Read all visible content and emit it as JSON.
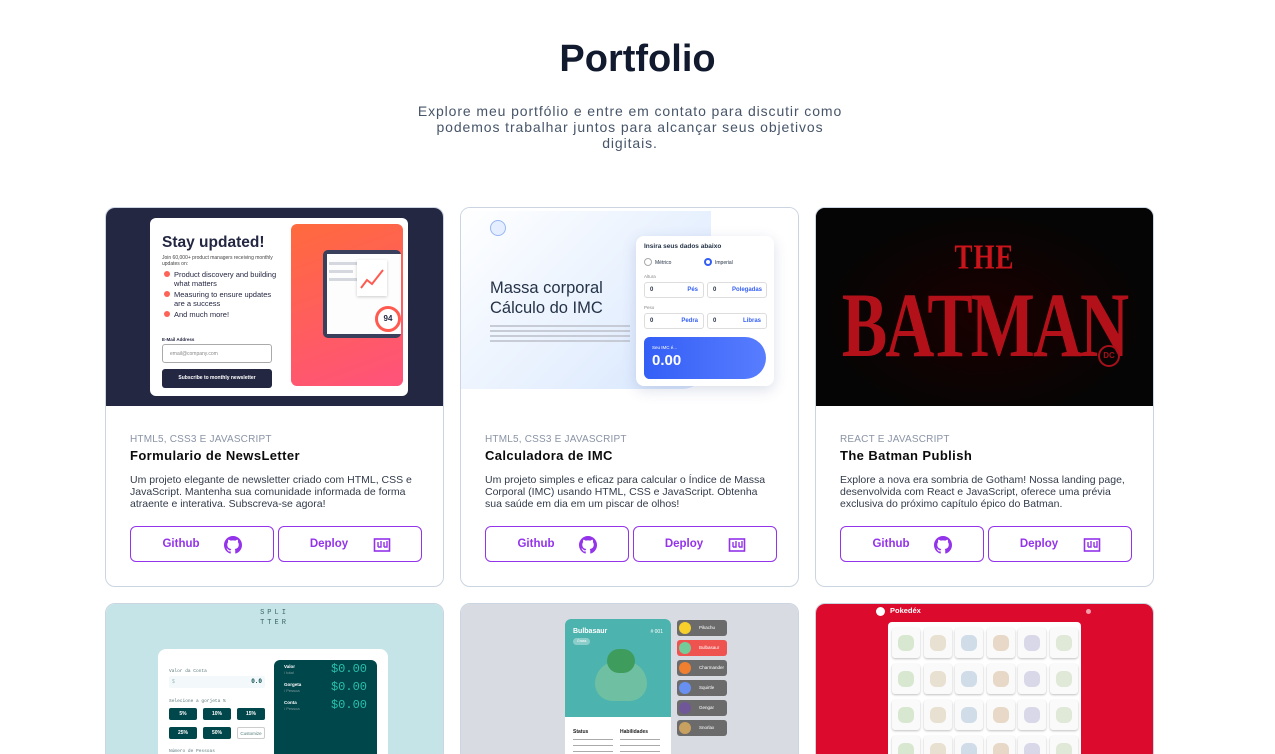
{
  "header": {
    "title": "Portfolio",
    "subtitle": "Explore meu portfólio e entre em contato para discutir como podemos trabalhar juntos para alcançar seus objetivos digitais."
  },
  "colors": {
    "accent": "#9333ea",
    "title": "#111a2e"
  },
  "projects": [
    {
      "tags": "HTML5, CSS3 E JAVASCRIPT",
      "title": "Formulario de NewsLetter",
      "description": "Um projeto elegante de newsletter criado com HTML, CSS e JavaScript. Mantenha sua comunidade informada de forma atraente e interativa. Subscreva-se agora!",
      "github_label": "Github",
      "deploy_label": "Deploy",
      "preview": {
        "heading": "Stay updated!",
        "intro": "Join 60,000+ product managers receiving monthly updates on:",
        "items": [
          "Product discovery and building what matters",
          "Measuring to ensure updates are a success",
          "And much more!"
        ],
        "email_label": "E-Mail Address",
        "email_placeholder": "email@company.com",
        "button": "Subscribe to monthly newsletter",
        "score": "94"
      }
    },
    {
      "tags": "HTML5, CSS3 E JAVASCRIPT",
      "title": "Calculadora de IMC",
      "description": "Um projeto simples e eficaz para calcular o Índice de Massa Corporal (IMC) usando HTML, CSS e JavaScript. Obtenha sua saúde em dia em um piscar de olhos!",
      "github_label": "Github",
      "deploy_label": "Deploy",
      "preview": {
        "heading_line1": "Massa corporal",
        "heading_line2": "Cálculo do IMC",
        "panel_title": "Insira seus dados abaixo",
        "opt_metric": "Métrico",
        "opt_imperial": "Imperial",
        "label_height": "Altura",
        "label_weight": "Peso",
        "zero": "0",
        "unit_feet": "Pés",
        "unit_inches": "Polegadas",
        "unit_stone": "Pedra",
        "unit_pounds": "Libras",
        "result_label": "Seu IMC é...",
        "result_value": "0.00"
      }
    },
    {
      "tags": "REACT E JAVASCRIPT",
      "title": "The Batman Publish",
      "description": "Explore a nova era sombria de Gotham! Nossa landing page, desenvolvida com React e JavaScript, oferece uma prévia exclusiva do próximo capítulo épico do Batman.",
      "github_label": "Github",
      "deploy_label": "Deploy",
      "preview": {
        "the": "THE",
        "batman": "BATMAN",
        "dc": "DC"
      }
    }
  ],
  "row2": {
    "splitter": {
      "logo_line1": "SPLI",
      "logo_line2": "TTER",
      "bill_label": "Valor da Conta",
      "bill_value": "0.0",
      "tip_label": "Selecione a gorjeta %",
      "tips": [
        "5%",
        "10%",
        "15%",
        "25%",
        "50%",
        "Customize"
      ],
      "people_label": "Número de Pessoas",
      "values": [
        "Valor",
        "Gorgeta",
        "Conta"
      ],
      "sub_labels": [
        "/ total",
        "/ Pessoa",
        "/ Pessoa"
      ],
      "amount": "$0.00"
    },
    "pokemon": {
      "name": "Bulbasaur",
      "number": "# 001",
      "type": "Grass",
      "status_label": "Status",
      "skills_label": "Habilidades",
      "list": [
        "Pikachu",
        "Bulbasaur",
        "Charmander",
        "Squirtle",
        "Gengar",
        "Snorlax"
      ]
    },
    "pokedex": {
      "title": "Pokedéx"
    }
  }
}
